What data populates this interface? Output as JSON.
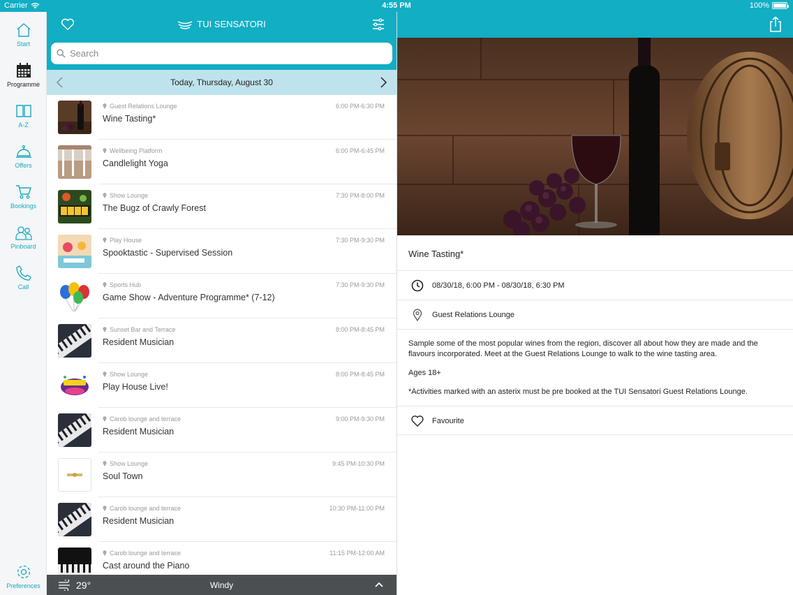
{
  "status_bar": {
    "carrier": "Carrier",
    "time": "4:55 PM",
    "battery": "100%"
  },
  "sidebar": {
    "items": [
      {
        "label": "Start",
        "icon": "home-icon"
      },
      {
        "label": "Programme",
        "icon": "calendar-icon"
      },
      {
        "label": "A-Z",
        "icon": "book-icon"
      },
      {
        "label": "Offers",
        "icon": "bell-icon"
      },
      {
        "label": "Bookings",
        "icon": "cart-icon"
      },
      {
        "label": "Pinboard",
        "icon": "people-icon"
      },
      {
        "label": "Call",
        "icon": "phone-icon"
      }
    ],
    "preferences_label": "Preferences"
  },
  "header": {
    "brand": "TUI SENSATORI"
  },
  "search": {
    "placeholder": "Search"
  },
  "date_bar": {
    "title": "Today, Thursday, August 30"
  },
  "events": [
    {
      "location": "Guest Relations Lounge",
      "time": "6:00 PM-6:30 PM",
      "title": "Wine Tasting*"
    },
    {
      "location": "Wellbeing Platform",
      "time": "6:00 PM-6:45 PM",
      "title": "Candlelight Yoga"
    },
    {
      "location": "Show Lounge",
      "time": "7:30 PM-8:00 PM",
      "title": "The Bugz of Crawly Forest"
    },
    {
      "location": "Play House",
      "time": "7:30 PM-9:30 PM",
      "title": "Spooktastic - Supervised Session"
    },
    {
      "location": "Sports Hub",
      "time": "7:30 PM-9:30 PM",
      "title": "Game Show - Adventure Programme* (7-12)"
    },
    {
      "location": "Sunset Bar and Terrace",
      "time": "8:00 PM-8:45 PM",
      "title": "Resident Musician"
    },
    {
      "location": "Show Lounge",
      "time": "8:00 PM-8:45 PM",
      "title": "Play House Live!"
    },
    {
      "location": "Carob lounge and terrace",
      "time": "9:00 PM-9:30 PM",
      "title": "Resident Musician"
    },
    {
      "location": "Show Lounge",
      "time": "9:45 PM-10:30 PM",
      "title": "Soul Town"
    },
    {
      "location": "Carob lounge and terrace",
      "time": "10:30 PM-11:00 PM",
      "title": "Resident Musician"
    },
    {
      "location": "Carob lounge and terrace",
      "time": "11:15 PM-12:00 AM",
      "title": "Cast around the Piano"
    }
  ],
  "weather": {
    "temp": "29°",
    "condition": "Windy"
  },
  "detail": {
    "title": "Wine Tasting*",
    "datetime": "08/30/18, 6:00 PM - 08/30/18, 6:30 PM",
    "location": "Guest Relations Lounge",
    "description": "Sample some of the most popular wines from the region, discover all about how they are made and the flavours incorporated. Meet at the Guest Relations Lounge to walk to the wine tasting area.",
    "ages": "Ages 18+",
    "note": "*Activities marked with an asterix must be pre booked at the TUI Sensatori Guest Relations Lounge.",
    "favourite_label": "Favourite"
  },
  "colors": {
    "accent": "#11aec4",
    "date_bar": "#bfe3ec",
    "weather_bar": "#4c4f52"
  }
}
